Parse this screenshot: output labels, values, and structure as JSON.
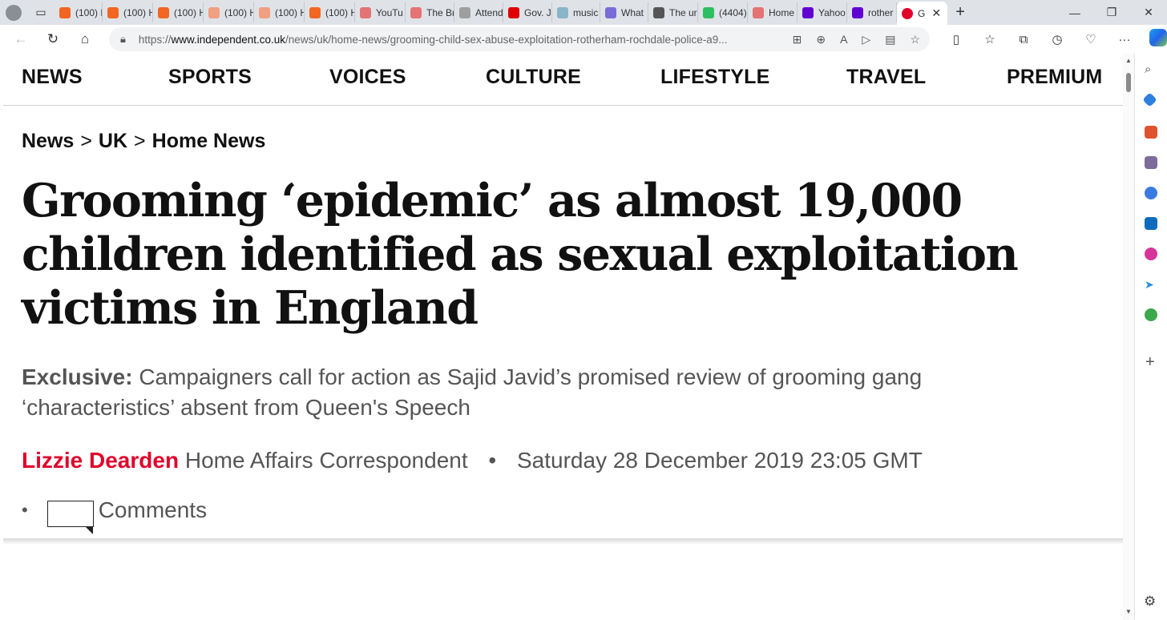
{
  "browser": {
    "tabs": [
      {
        "label": "(100) E",
        "color": "#f26522"
      },
      {
        "label": "(100) H",
        "color": "#f26522"
      },
      {
        "label": "(100) H",
        "color": "#f26522"
      },
      {
        "label": "(100) H",
        "color": "#f0a080"
      },
      {
        "label": "(100) H",
        "color": "#f0a080"
      },
      {
        "label": "(100) H",
        "color": "#f26522"
      },
      {
        "label": "YouTu",
        "color": "#e57373"
      },
      {
        "label": "The Br",
        "color": "#e57373"
      },
      {
        "label": "Attend",
        "color": "#9e9e9e"
      },
      {
        "label": "Gov. J",
        "color": "#e00000"
      },
      {
        "label": "music",
        "color": "#8ab4c8"
      },
      {
        "label": "What",
        "color": "#7a6cd6"
      },
      {
        "label": "The ur",
        "color": "#555555"
      },
      {
        "label": "(4404)",
        "color": "#2dbe60"
      },
      {
        "label": "Home",
        "color": "#e57373"
      },
      {
        "label": "Yahoo",
        "color": "#6001d2"
      },
      {
        "label": "rother",
        "color": "#6001d2"
      }
    ],
    "active_tab": {
      "label": "G",
      "color": "#e0002b"
    },
    "url_prefix": "https://",
    "url_host": "www.independent.co.uk",
    "url_path": "/news/uk/home-news/grooming-child-sex-abuse-exploitation-rotherham-rochdale-police-a9..."
  },
  "site": {
    "nav": [
      "NEWS",
      "SPORTS",
      "VOICES",
      "CULTURE",
      "LIFESTYLE",
      "TRAVEL",
      "PREMIUM"
    ],
    "breadcrumb": [
      "News",
      "UK",
      "Home News"
    ],
    "breadcrumb_sep": ">"
  },
  "article": {
    "headline": "Grooming ‘epidemic’ as almost 19,000 children identified as sexual exploitation victims in England",
    "standfirst_label": "Exclusive:",
    "standfirst": "Campaigners call for action as Sajid Javid’s promised review of grooming gang ‘characteristics’ absent from Queen's Speech",
    "author": "Lizzie Dearden",
    "role": "Home Affairs Correspondent",
    "date": "Saturday 28 December 2019 23:05 GMT",
    "comments_label": "Comments"
  },
  "colors": {
    "accent_red": "#e0002b",
    "headline": "#111111",
    "secondary_text": "#555555"
  }
}
